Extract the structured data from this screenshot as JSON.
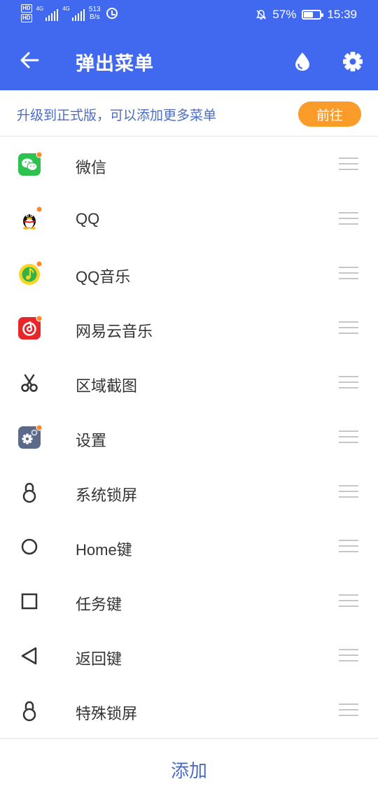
{
  "status_bar": {
    "hd1": "HD",
    "hd2": "HD",
    "net1": "4G",
    "net2": "4G",
    "speed_value": "513",
    "speed_unit": "B/s",
    "battery": "57%",
    "battery_level": 0.57,
    "time": "15:39"
  },
  "app_bar": {
    "title": "弹出菜单",
    "back_icon": "arrow-left-icon",
    "theme_icon": "water-drop-icon",
    "settings_icon": "gear-icon"
  },
  "banner": {
    "text": "升级到正式版，可以添加更多菜单",
    "button": "前往"
  },
  "menu_items": [
    {
      "label": "微信",
      "icon": "wechat-icon"
    },
    {
      "label": "QQ",
      "icon": "qq-icon"
    },
    {
      "label": "QQ音乐",
      "icon": "qq-music-icon"
    },
    {
      "label": "网易云音乐",
      "icon": "netease-music-icon"
    },
    {
      "label": "区域截图",
      "icon": "scissors-icon"
    },
    {
      "label": "设置",
      "icon": "settings-app-icon"
    },
    {
      "label": "系统锁屏",
      "icon": "lock-icon"
    },
    {
      "label": "Home键",
      "icon": "circle-home-icon"
    },
    {
      "label": "任务键",
      "icon": "square-task-icon"
    },
    {
      "label": "返回键",
      "icon": "triangle-back-icon"
    },
    {
      "label": "特殊锁屏",
      "icon": "lock-icon"
    }
  ],
  "footer": {
    "add_label": "添加"
  },
  "colors": {
    "primary": "#4169f0",
    "accent": "#fb9c2a",
    "link": "#4a6cc6"
  }
}
